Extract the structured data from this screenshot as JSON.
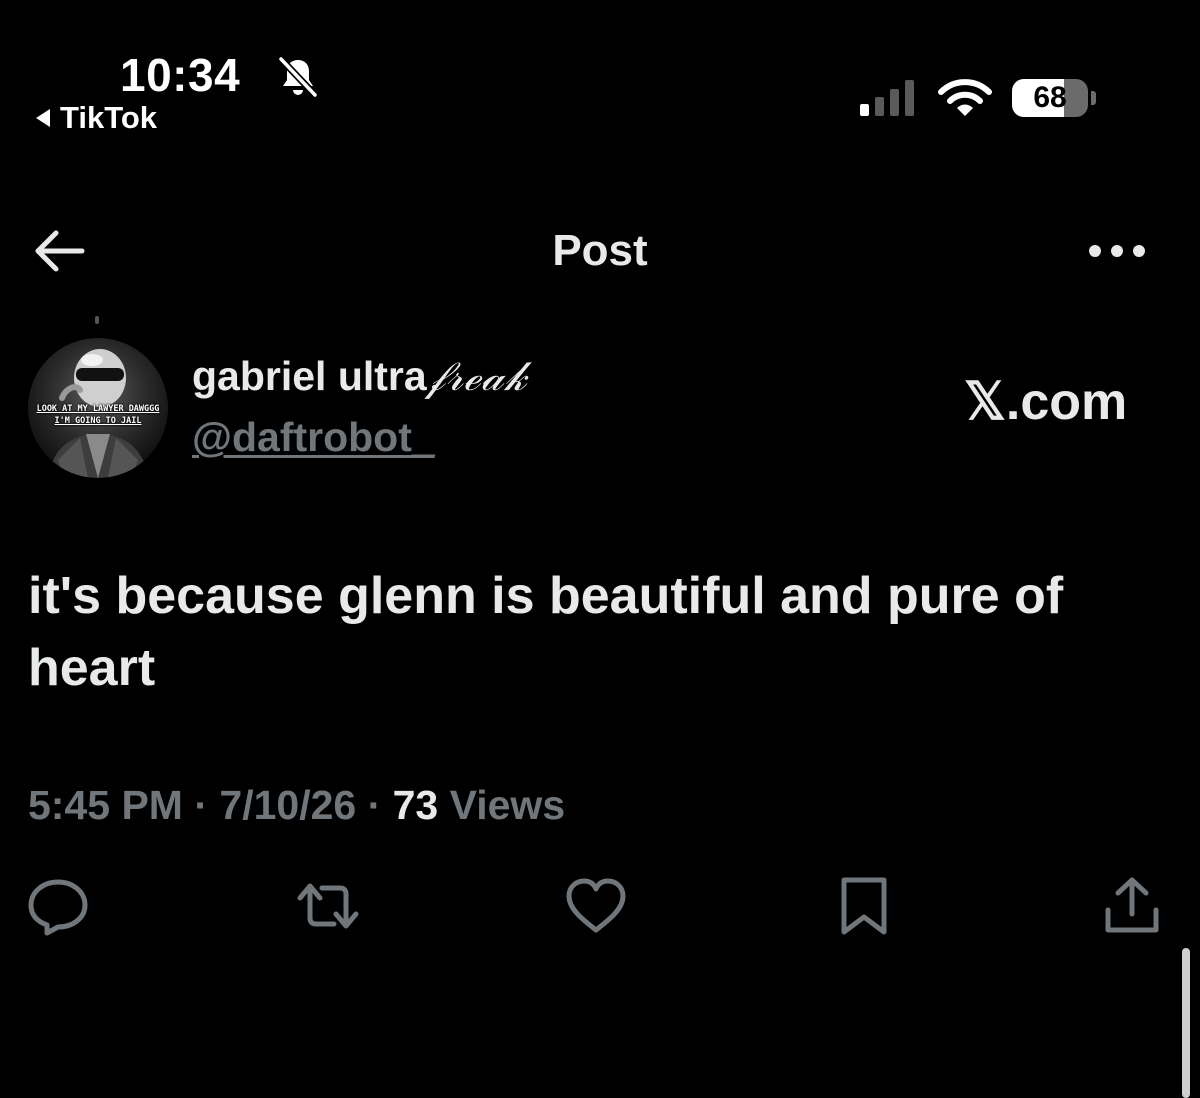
{
  "status_bar": {
    "time": "10:34",
    "back_app_label": "TikTok",
    "battery_percent": "68",
    "battery_level": 0.68,
    "icons": [
      "bell-slash-icon",
      "cellular-signal-icon",
      "wifi-icon",
      "battery-icon"
    ]
  },
  "header": {
    "title": "Post",
    "icons": [
      "back-arrow-icon",
      "more-dots-icon"
    ]
  },
  "author": {
    "name_plain": "gabriel ultra",
    "name_fancy": "𝒻𝓇ℯ𝒶𝓀",
    "handle": "@daftrobot_",
    "avatar_caption_line1": "LOOK AT MY LAWYER DAWGGG",
    "avatar_caption_line2": "I'M GOING TO JAIL"
  },
  "watermark": "𝕏.com",
  "post": {
    "text": "it's because glenn is beautiful and pure of heart"
  },
  "meta": {
    "time": "5:45 PM",
    "separator": " · ",
    "date": "7/10/26",
    "views_count": "73",
    "views_label": " Views"
  },
  "actions": [
    "reply-icon",
    "repost-icon",
    "like-icon",
    "bookmark-icon",
    "share-icon"
  ],
  "colors": {
    "background": "#000000",
    "primary_text": "#e7e9ea",
    "secondary_text": "#71767b"
  }
}
